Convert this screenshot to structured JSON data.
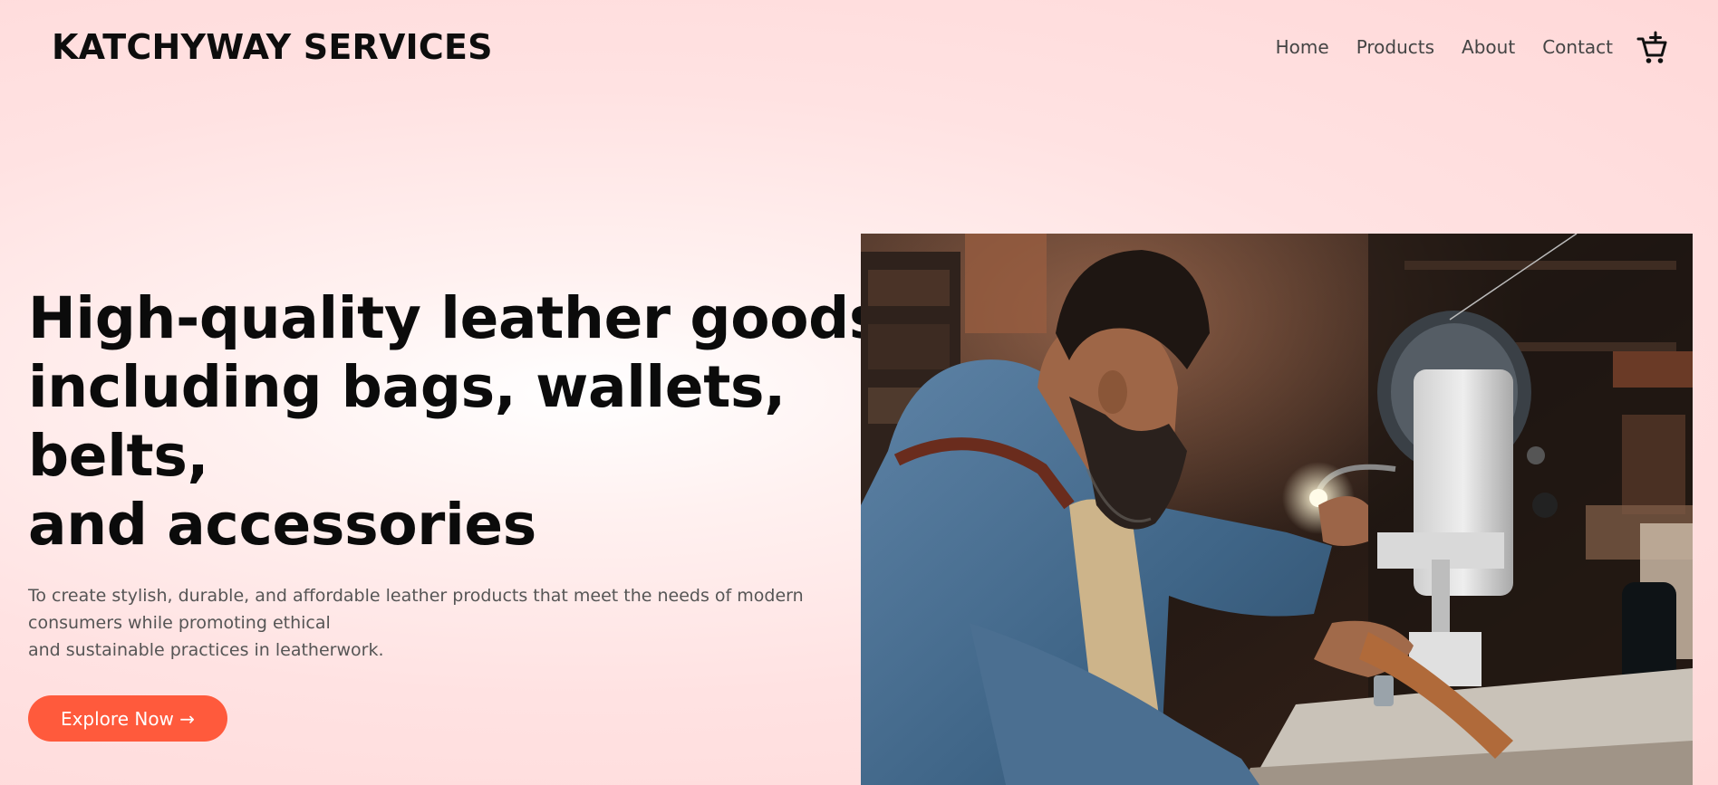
{
  "brand": {
    "name": "KATCHYWAY SERVICES"
  },
  "nav": {
    "items": [
      "Home",
      "Products",
      "About",
      "Contact"
    ],
    "cart_icon": "cart-plus-icon"
  },
  "hero": {
    "title_lines": [
      "High-quality leather goods",
      "including bags, wallets,",
      "belts,",
      "and accessories"
    ],
    "description_lines": [
      "To create stylish, durable, and affordable leather products that meet the needs of modern",
      "consumers while promoting ethical",
      "and sustainable practices in leatherwork."
    ],
    "cta_label": "Explore Now →"
  },
  "colors": {
    "accent": "#ff5a3c",
    "background": "#ffdede",
    "heading": "#0b0b0b",
    "body_text": "#555555"
  }
}
